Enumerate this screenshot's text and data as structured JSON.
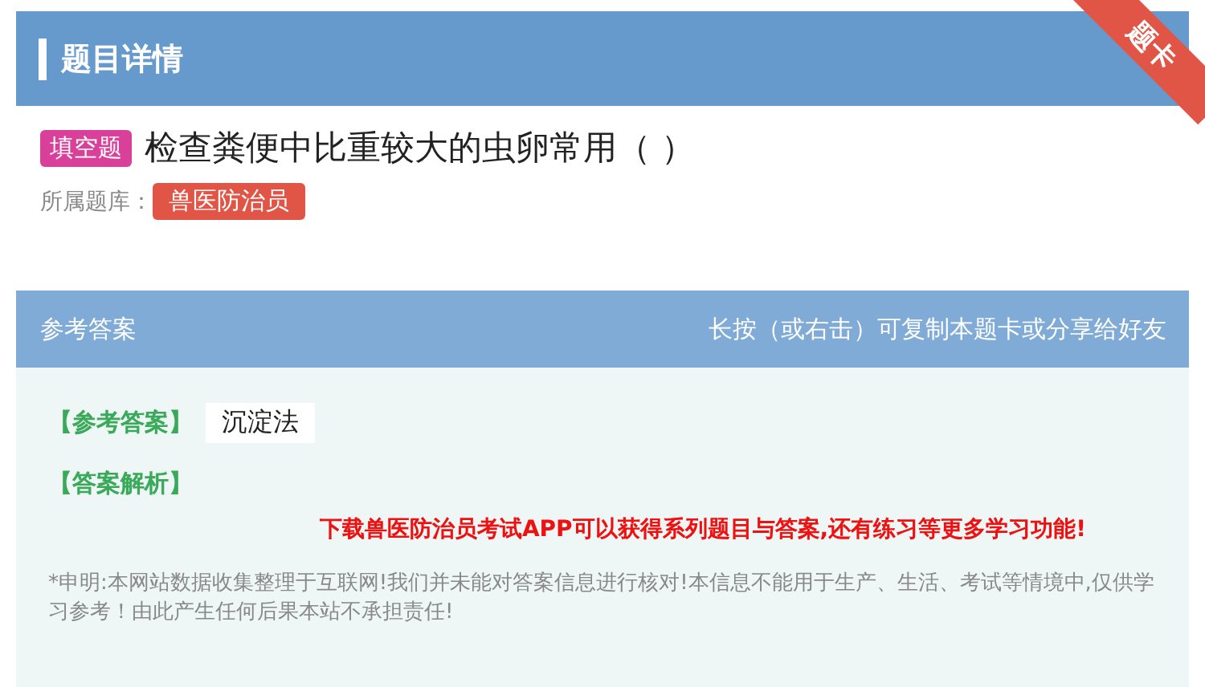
{
  "header": {
    "title": "题目详情",
    "ribbon": "题卡"
  },
  "question": {
    "type_tag": "填空题",
    "text": "检查粪便中比重较大的虫卵常用（ ）",
    "library_label": "所属题库：",
    "library": "兽医防治员"
  },
  "answer_panel": {
    "title": "参考答案",
    "hint": "长按（或右击）可复制本题卡或分享给好友",
    "answer_label": "【参考答案】",
    "answer": "沉淀法",
    "analysis_label": "【答案解析】",
    "promo": "下载兽医防治员考试APP可以获得系列题目与答案,还有练习等更多学习功能!",
    "disclaimer": "*申明:本网站数据收集整理于互联网!我们并未能对答案信息进行核对!本信息不能用于生产、生活、考试等情境中,仅供学习参考！由此产生任何后果本站不承担责任!"
  }
}
